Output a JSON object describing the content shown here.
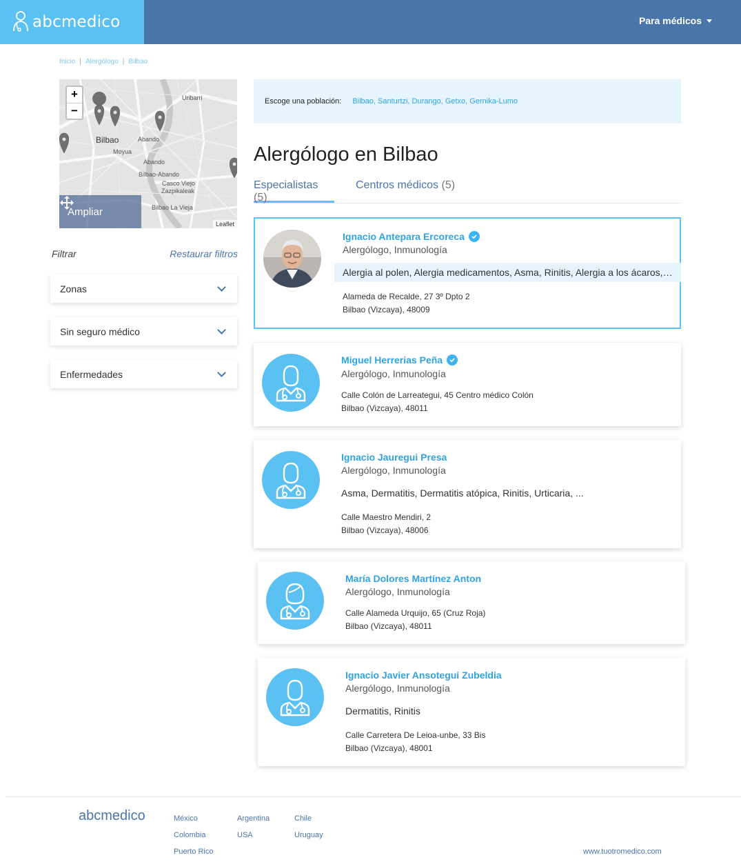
{
  "header": {
    "logo": "abcmedico",
    "for_doctors": "Para médicos"
  },
  "breadcrumb": [
    "Inicio",
    "Alergólogo",
    "Bilbao"
  ],
  "map": {
    "zoom_in": "+",
    "zoom_out": "−",
    "expand_label": "Ampliar",
    "attribution": "Leaflet",
    "labels": [
      "Bilbao",
      "Abando",
      "Moyua",
      "Uribarri",
      "Abando",
      "Casco Viejo",
      "Zazpikaleak",
      "Bilbao La Vieja",
      "Bilbao-Abando"
    ]
  },
  "filters": {
    "title": "Filtrar",
    "reset": "Restaurar filtros",
    "items": [
      "Zonas",
      "Sin seguro médico",
      "Enfermedades"
    ]
  },
  "population": {
    "label": "Escoge una población:",
    "links": "Bilbao, Santurtzi, Durango, Getxo, Gernika-Lumo"
  },
  "title": "Alergólogo en Bilbao",
  "tabs": [
    {
      "label": "Especialistas",
      "count": "(5)"
    },
    {
      "label": "Centros médicos",
      "count": "(5)"
    }
  ],
  "doctors": [
    {
      "name": "Ignacio Antepara Ercoreca",
      "specialty": "Alergólogo, Inmunología",
      "tags": "Alergia al polen, Alergia medicamentos, Asma, Rinitis, Alergia a los ácaros, ...",
      "address1": "Alameda de Recalde, 27 3º Dpto 2",
      "address2": "Bilbao (Vizcaya), 48009"
    },
    {
      "name": "Miguel Herrerias Peña",
      "specialty": "Alergólogo, Inmunología",
      "tags": "",
      "address1": "Calle Colón de Larreategui, 45 Centro médico Colón",
      "address2": "Bilbao (Vizcaya), 48011"
    },
    {
      "name": "Ignacio Jauregui Presa",
      "specialty": "Alergólogo, Inmunología",
      "tags": "Asma, Dermatitis, Dermatitis atópica, Rinitis, Urticaria, ...",
      "address1": "Calle Maestro Mendiri, 2",
      "address2": "Bilbao (Vizcaya), 48006"
    },
    {
      "name": "María Dolores Martínez Anton",
      "specialty": "Alergólogo, Inmunología",
      "tags": "",
      "address1": "Calle Alameda Urquijo, 65 (Cruz Roja)",
      "address2": "Bilbao (Vizcaya), 48011"
    },
    {
      "name": "Ignacio Javier Ansotegui Zubeldia",
      "specialty": "Alergólogo, Inmunología",
      "tags": "Dermatitis, Rinitis",
      "address1": "Calle Carretera De Leioa-unbe, 33 Bis",
      "address2": "Bilbao (Vizcaya), 48001"
    }
  ],
  "footer": {
    "logo": "abcmedico",
    "col1": [
      "México",
      "Colombia",
      "Puerto Rico"
    ],
    "col2": [
      "Argentina",
      "USA"
    ],
    "col3": [
      "Chile",
      "Uruguay"
    ],
    "site": "www.tuotromedico.com"
  },
  "colors": {
    "header": "#4a75a8",
    "accent": "#5bc0f2",
    "link": "#2fa3e0"
  }
}
